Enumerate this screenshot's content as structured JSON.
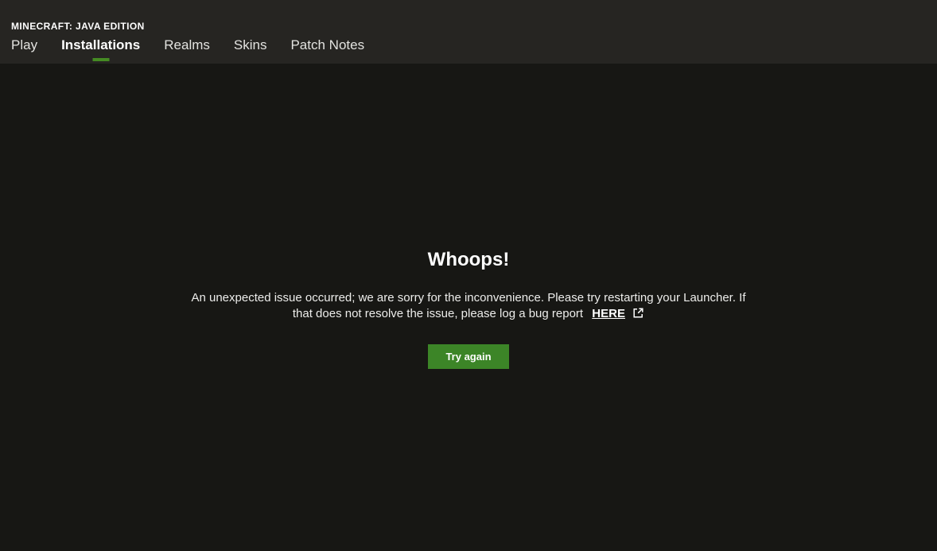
{
  "header": {
    "app_title": "MINECRAFT: JAVA EDITION",
    "tabs": [
      {
        "label": "Play",
        "active": false
      },
      {
        "label": "Installations",
        "active": true
      },
      {
        "label": "Realms",
        "active": false
      },
      {
        "label": "Skins",
        "active": false
      },
      {
        "label": "Patch Notes",
        "active": false
      }
    ]
  },
  "main": {
    "error_title": "Whoops!",
    "error_message": "An unexpected issue occurred; we are sorry for the inconvenience. Please try restarting your Launcher. If that does not resolve the issue, please log a bug report",
    "link_label": "HERE",
    "try_again_label": "Try again"
  },
  "icons": {
    "external_link": "external-link-icon"
  },
  "colors": {
    "header_bg": "#262522",
    "body_bg": "#171714",
    "accent_green": "#3c8527",
    "tab_underline_green": "#458b23",
    "tab_text": "#e3e3e0",
    "text_white": "#ffffff",
    "message_text": "#ededeb"
  }
}
